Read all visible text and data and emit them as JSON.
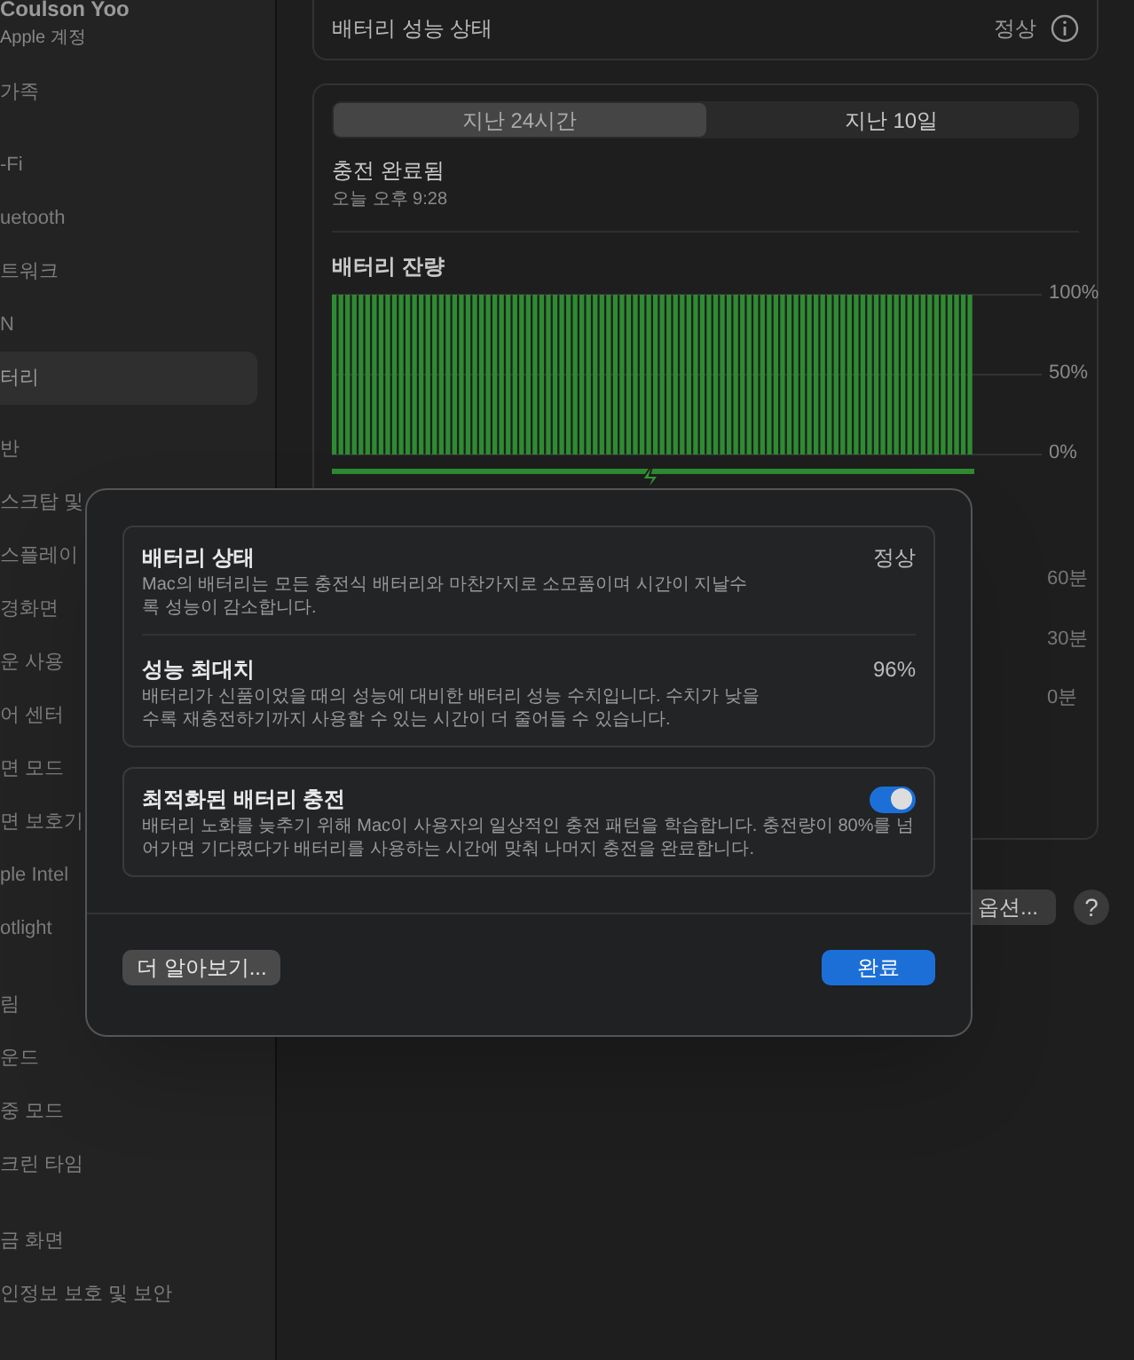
{
  "sidebar": {
    "account": {
      "name": "Coulson Yoo",
      "subtitle": "Apple 계정"
    },
    "items": [
      {
        "label": "가족",
        "selected": false
      },
      {
        "label": "-Fi",
        "selected": false
      },
      {
        "label": "uetooth",
        "selected": false
      },
      {
        "label": "트워크",
        "selected": false
      },
      {
        "label": "N",
        "selected": false
      },
      {
        "label": "터리",
        "selected": true
      },
      {
        "label": "반",
        "selected": false
      },
      {
        "label": "스크탑 및",
        "selected": false
      },
      {
        "label": "스플레이",
        "selected": false
      },
      {
        "label": "경화면",
        "selected": false
      },
      {
        "label": "운 사용",
        "selected": false
      },
      {
        "label": "어 센터",
        "selected": false
      },
      {
        "label": "면 모드",
        "selected": false
      },
      {
        "label": "면 보호기",
        "selected": false
      },
      {
        "label": "ple Intel",
        "selected": false
      },
      {
        "label": "otlight",
        "selected": false
      },
      {
        "label": "림",
        "selected": false
      },
      {
        "label": "운드",
        "selected": false
      },
      {
        "label": "중 모드",
        "selected": false
      },
      {
        "label": "크린 타임",
        "selected": false
      },
      {
        "label": "금 화면",
        "selected": false
      },
      {
        "label": "인정보 보호 및 보안",
        "selected": false
      }
    ]
  },
  "health_row": {
    "label": "배터리 성능 상태",
    "value": "정상"
  },
  "tabs": [
    {
      "label": "지난 24시간",
      "selected": true
    },
    {
      "label": "지난 10일",
      "selected": false
    }
  ],
  "charge_status": {
    "title": "충전 완료됨",
    "time": "오늘 오후 9:28"
  },
  "battery_chart": {
    "chart_data": {
      "type": "bar",
      "title": "배터리 잔량",
      "ylim": [
        0,
        100
      ],
      "yticks": [
        {
          "value": 100,
          "label": "100%"
        },
        {
          "value": 50,
          "label": "50%"
        },
        {
          "value": 0,
          "label": "0%"
        }
      ],
      "series": [
        {
          "color": "#2e8b32",
          "values": [
            100,
            100,
            100,
            100,
            100,
            100,
            100,
            100,
            100,
            100,
            100,
            100,
            100,
            100,
            100,
            100,
            100,
            100,
            100,
            100,
            100,
            100,
            100,
            100,
            100,
            100,
            100,
            100,
            100,
            100,
            100,
            100,
            100,
            100,
            100,
            100,
            100,
            100,
            100,
            100,
            100,
            100,
            100,
            100,
            100,
            100,
            100,
            100,
            100,
            100,
            100,
            100,
            100,
            100,
            100,
            100,
            100,
            100,
            100,
            100,
            100,
            100,
            100,
            100,
            100,
            100,
            100,
            100,
            100,
            100,
            100,
            100,
            100,
            100,
            100,
            100,
            100,
            100,
            100,
            100,
            100,
            100,
            100,
            100,
            100,
            100,
            100,
            100,
            100,
            100,
            100,
            100,
            100,
            100,
            100,
            100
          ]
        }
      ]
    }
  },
  "usage_axis": [
    "60분",
    "30분",
    "0분"
  ],
  "footer_buttons": {
    "options": "옵션...",
    "help": "?"
  },
  "dialog": {
    "sections": [
      {
        "kind": "info",
        "rows": [
          {
            "title": "배터리 상태",
            "value": "정상",
            "description": "Mac의 배터리는 모든 충전식 배터리와 마찬가지로 소모품이며 시간이 지날수록 성능이 감소합니다."
          },
          {
            "title": "성능 최대치",
            "value": "96%",
            "description": "배터리가 신품이었을 때의 성능에 대비한 배터리 성능 수치입니다. 수치가 낮을수록 재충전하기까지 사용할 수 있는 시간이 더 줄어들 수 있습니다."
          }
        ]
      },
      {
        "kind": "toggle",
        "title": "최적화된 배터리 충전",
        "on": true,
        "description": "배터리 노화를 늦추기 위해 Mac이 사용자의 일상적인 충전 패턴을 학습합니다. 충전량이 80%를 넘어가면 기다렸다가 배터리를 사용하는 시간에 맞춰 나머지 충전을 완료합니다."
      }
    ],
    "learn_more": "더 알아보기...",
    "done": "완료"
  }
}
